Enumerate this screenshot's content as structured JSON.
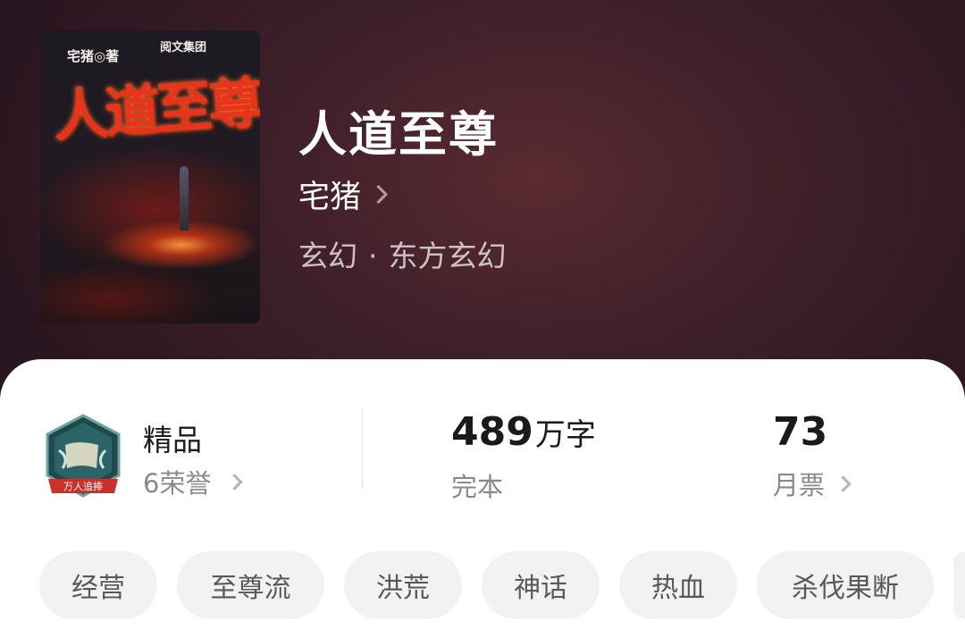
{
  "book": {
    "title": "人道至尊",
    "author": "宅猪",
    "genre_main": "玄幻",
    "genre_separator": "·",
    "genre_sub": "东方玄幻"
  },
  "cover": {
    "title_text": "人道至尊",
    "author_text": "宅猪◎著",
    "publisher_text": "阅文集团"
  },
  "stats": {
    "badge_text": "万人追捧",
    "quality_label": "精品",
    "honors": "6荣誉",
    "word_count": "489",
    "word_unit": "万字",
    "status": "完本",
    "monthly_tickets": "73",
    "monthly_tickets_label": "月票"
  },
  "tags": [
    "经营",
    "至尊流",
    "洪荒",
    "神话",
    "热血",
    "杀伐果断"
  ],
  "icons": [
    "chevron-right-icon",
    "honor-badge-icon"
  ],
  "colors": {
    "header_bg": "#40202a",
    "card_bg": "#ffffff",
    "tag_bg": "#f2f2f2",
    "badge_green": "#1f4a4c",
    "badge_red": "#c9312a"
  }
}
